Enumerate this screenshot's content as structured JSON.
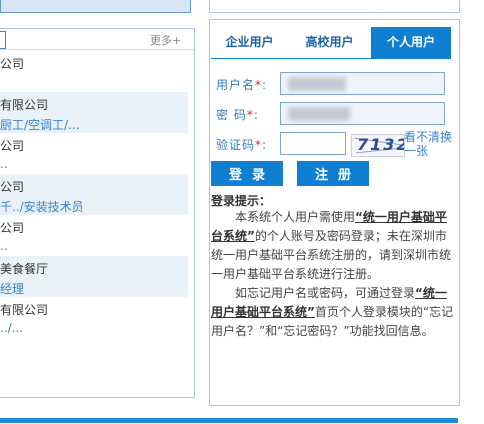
{
  "left": {
    "more_link": "更多+",
    "items": [
      {
        "company": "公司",
        "position": ""
      },
      {
        "company": "有限公司",
        "position": "厨工/空调工/..."
      },
      {
        "company": "公司",
        "position": ".."
      },
      {
        "company": "公司",
        "position": "千../安装技术员"
      },
      {
        "company": "公司",
        "position": ".."
      },
      {
        "company": "美食餐厅",
        "position": "经理"
      },
      {
        "company": "有限公司",
        "position": "../..."
      }
    ]
  },
  "login": {
    "tabs": [
      {
        "label": "企业用户",
        "active": false
      },
      {
        "label": "高校用户",
        "active": false
      },
      {
        "label": "个人用户",
        "active": true
      }
    ],
    "username_label": "用户名",
    "password_label": "密 码",
    "captcha_label": "验证码",
    "required_mark": "*",
    "label_colon": ":",
    "captcha_text": "7132",
    "refresh_link": "看不清换一张",
    "login_button": "登录",
    "register_button": "注册",
    "tips_title": "登录提示：",
    "tips": {
      "p1_before": "本系统个人用户需使用",
      "p1_link": "“统一用户基础平台系统”",
      "p1_after": "的个人账号及密码登录；未在深圳市统一用户基础平台系统注册的，请到深圳市统一用户基础平台系统进行注册。",
      "p2_before": "如忘记用户名或密码，可通过登录",
      "p2_link": "“统一用户基础平台系统”",
      "p2_after": "首页个人登录模块的“忘记用户名？”和“忘记密码？”功能找回信息。"
    }
  },
  "colors": {
    "accent": "#0f7fd1",
    "label": "#2f7cc2",
    "required": "#e02424",
    "link": "#3a84c8",
    "row_shade": "#eaf2f9"
  }
}
